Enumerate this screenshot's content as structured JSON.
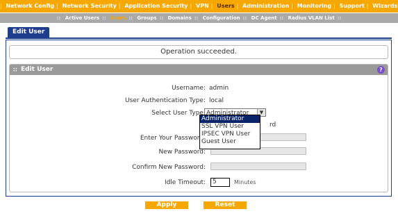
{
  "topnav": {
    "items": [
      "Network Config",
      "Network Security",
      "Application Security",
      "VPN",
      "Users",
      "Administration",
      "Monitoring",
      "Support",
      "Wizards"
    ],
    "active": "Users"
  },
  "subnav": {
    "items": [
      "Active Users",
      "Users",
      "Groups",
      "Domains",
      "Configuration",
      "DC Agent",
      "Radius VLAN List"
    ],
    "active": "Users"
  },
  "tab": {
    "label": "Edit User"
  },
  "message": "Operation succeeded.",
  "panel": {
    "title": "Edit User",
    "help_icon": "?"
  },
  "form": {
    "username_label": "Username:",
    "username_value": "admin",
    "auth_type_label": "User Authentication Type:",
    "auth_type_value": "local",
    "user_type_label": "Select User Type:",
    "user_type_value": "Administrator",
    "user_type_options": [
      "Administrator",
      "SSL VPN User",
      "IPSEC VPN User",
      "Guest User"
    ],
    "checkbox_suffix": "rd",
    "enter_password_label": "Enter Your Password:",
    "new_password_label": "New Password:",
    "confirm_password_label": "Confirm New Password:",
    "idle_timeout_label": "Idle Timeout:",
    "idle_timeout_value": "5",
    "idle_timeout_unit": "Minutes"
  },
  "buttons": {
    "apply": "Apply",
    "reset": "Reset"
  },
  "colors": {
    "topnav_bg": "#f6a800",
    "accent_blue": "#1e3d8f",
    "panel_header": "#9a9a9a",
    "selected_option": "#0a246a"
  }
}
